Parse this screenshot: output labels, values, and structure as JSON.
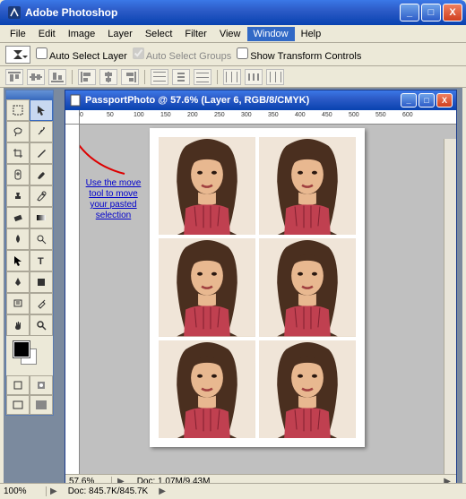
{
  "app": {
    "title": "Adobe Photoshop"
  },
  "window_controls": {
    "min": "_",
    "max": "□",
    "close": "X"
  },
  "menu": {
    "items": [
      "File",
      "Edit",
      "Image",
      "Layer",
      "Select",
      "Filter",
      "View",
      "Window",
      "Help"
    ],
    "active": "Window"
  },
  "options": {
    "auto_select_layer": "Auto Select Layer",
    "auto_select_groups": "Auto Select Groups",
    "show_transform": "Show Transform Controls"
  },
  "toolbox": {
    "tools": [
      "marquee",
      "move",
      "lasso",
      "wand",
      "crop",
      "slice",
      "heal",
      "brush",
      "stamp",
      "history",
      "eraser",
      "gradient",
      "blur",
      "dodge",
      "path",
      "type",
      "pen",
      "shape",
      "notes",
      "eyedrop",
      "hand",
      "zoom"
    ]
  },
  "document": {
    "title": "PassportPhoto @ 57.6% (Layer 6, RGB/8/CMYK)",
    "ruler_h": [
      "0",
      "50",
      "100",
      "150",
      "200",
      "250",
      "300",
      "350",
      "400",
      "450",
      "500",
      "550",
      "600"
    ],
    "zoom": "57.6%",
    "info": "Doc: 1.07M/9.43M"
  },
  "annotation": "Use the move tool to move your pasted selection",
  "status": {
    "zoom": "100%",
    "info": "Doc: 845.7K/845.7K"
  }
}
